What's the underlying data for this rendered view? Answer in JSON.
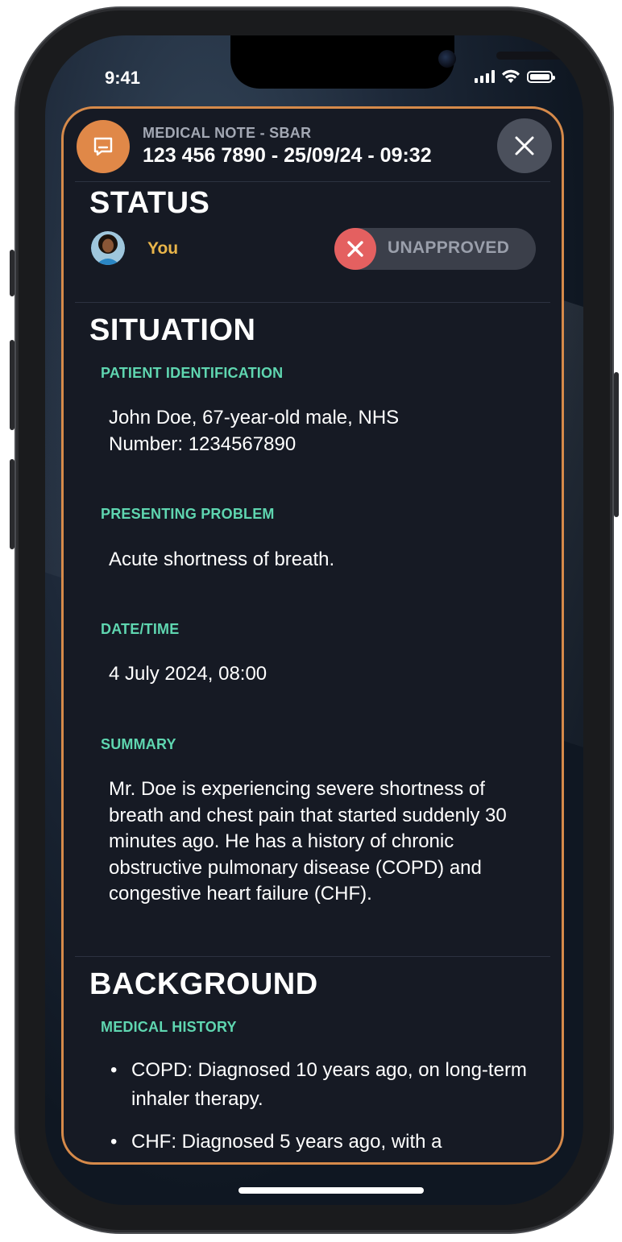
{
  "status_bar": {
    "time": "9:41",
    "icons": [
      "cellular-signal-icon",
      "wifi-icon",
      "battery-icon"
    ]
  },
  "header": {
    "icon": "note-icon",
    "kicker": "MEDICAL NOTE - SBAR",
    "note_id": "123 456 7890 - 25/09/24 - 09:32",
    "close_icon": "close-icon"
  },
  "status_section": {
    "title": "STATUS",
    "author_label": "You",
    "approval": {
      "state_text": "UNAPPROVED",
      "icon": "x-icon",
      "color": "#e46060"
    }
  },
  "situation": {
    "title": "SITUATION",
    "fields": [
      {
        "label": "PATIENT IDENTIFICATION",
        "value": "John Doe, 67-year-old male, NHS Number: 1234567890"
      },
      {
        "label": "PRESENTING PROBLEM",
        "value": "Acute shortness of breath."
      },
      {
        "label": "DATE/TIME",
        "value": "4 July 2024, 08:00"
      },
      {
        "label": "SUMMARY",
        "value": "Mr. Doe is experiencing severe shortness of breath and chest pain that started suddenly 30 minutes ago. He has a history of chronic obstructive pulmonary disease (COPD) and congestive heart failure (CHF)."
      }
    ]
  },
  "background": {
    "title": "BACKGROUND",
    "medical_history_label": "MEDICAL HISTORY",
    "bullet": "•",
    "medical_history": [
      "COPD: Diagnosed 10 years ago, on long-term inhaler therapy.",
      "CHF: Diagnosed 5 years ago, with a"
    ]
  },
  "colors": {
    "accent_border": "#d68a4a",
    "label_teal": "#5fd6b0",
    "author_yellow": "#e9b54a",
    "card_bg": "#161a24"
  }
}
